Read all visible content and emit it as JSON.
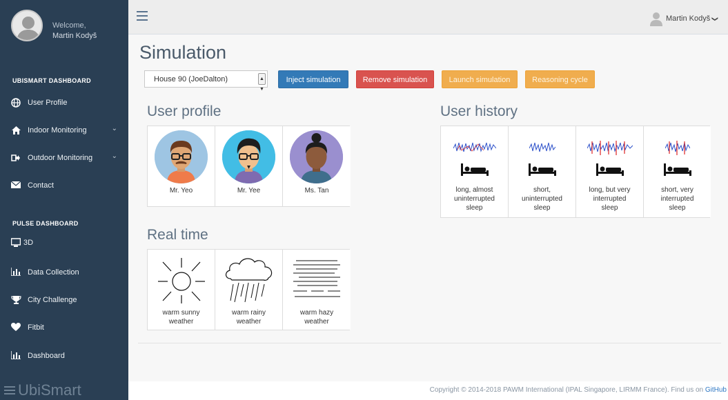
{
  "sidebar": {
    "welcome": "Welcome,",
    "user_name": "Martin Kodyš",
    "sections": [
      {
        "title": "UBISMART DASHBOARD",
        "items": [
          {
            "label": "User Profile",
            "icon": "globe-icon"
          },
          {
            "label": "Indoor Monitoring",
            "icon": "home-icon",
            "has_chevron": true
          },
          {
            "label": "Outdoor Monitoring",
            "icon": "sign-out-icon",
            "has_chevron": true
          },
          {
            "label": "Contact",
            "icon": "envelope-icon"
          }
        ]
      },
      {
        "title": "PULSE DASHBOARD",
        "items": [
          {
            "label": "3D",
            "icon": "desktop-icon"
          },
          {
            "label": "Data Collection",
            "icon": "bar-chart-icon"
          },
          {
            "label": "City Challenge",
            "icon": "trophy-icon"
          },
          {
            "label": "Fitbit",
            "icon": "heart-icon"
          },
          {
            "label": "Dashboard",
            "icon": "bar-chart-icon"
          }
        ]
      }
    ],
    "brand": "UbiSmart"
  },
  "topbar": {
    "user_name": "Martin Kodyš",
    "chevron": "❯"
  },
  "main": {
    "title": "Simulation",
    "house_select": {
      "value": "House 90 (JoeDalton)"
    },
    "buttons": {
      "inject": "Inject simulation",
      "remove": "Remove simulation",
      "launch": "Launch simulation",
      "reasoning": "Reasoning cycle"
    },
    "user_profile": {
      "heading": "User profile",
      "people": [
        {
          "name": "Mr. Yeo",
          "color": "#9ec5e3"
        },
        {
          "name": "Mr. Yee",
          "color": "#42bde5"
        },
        {
          "name": "Ms. Tan",
          "color": "#9a8fcf"
        }
      ]
    },
    "user_history": {
      "heading": "User history",
      "items": [
        {
          "line1": "long, almost",
          "line2": "uninterrupted",
          "line3": "sleep"
        },
        {
          "line1": "short,",
          "line2": "uninterrupted",
          "line3": "sleep"
        },
        {
          "line1": "long, but very",
          "line2": "interrupted",
          "line3": "sleep"
        },
        {
          "line1": "short, very",
          "line2": "interrupted",
          "line3": "sleep"
        }
      ]
    },
    "real_time": {
      "heading": "Real time",
      "items": [
        {
          "line1": "warm sunny",
          "line2": "weather"
        },
        {
          "line1": "warm rainy",
          "line2": "weather"
        },
        {
          "line1": "warm hazy",
          "line2": "weather"
        }
      ]
    }
  },
  "footer": {
    "copyright": "Copyright © 2014-2018 PAWM International (IPAL Singapore, LIRMM France). Find us on ",
    "link": "GitHub"
  },
  "colors": {
    "sidebar_bg": "#2a3f54",
    "primary": "#337ab7",
    "danger": "#d9534f",
    "warning": "#f0ad4e"
  }
}
